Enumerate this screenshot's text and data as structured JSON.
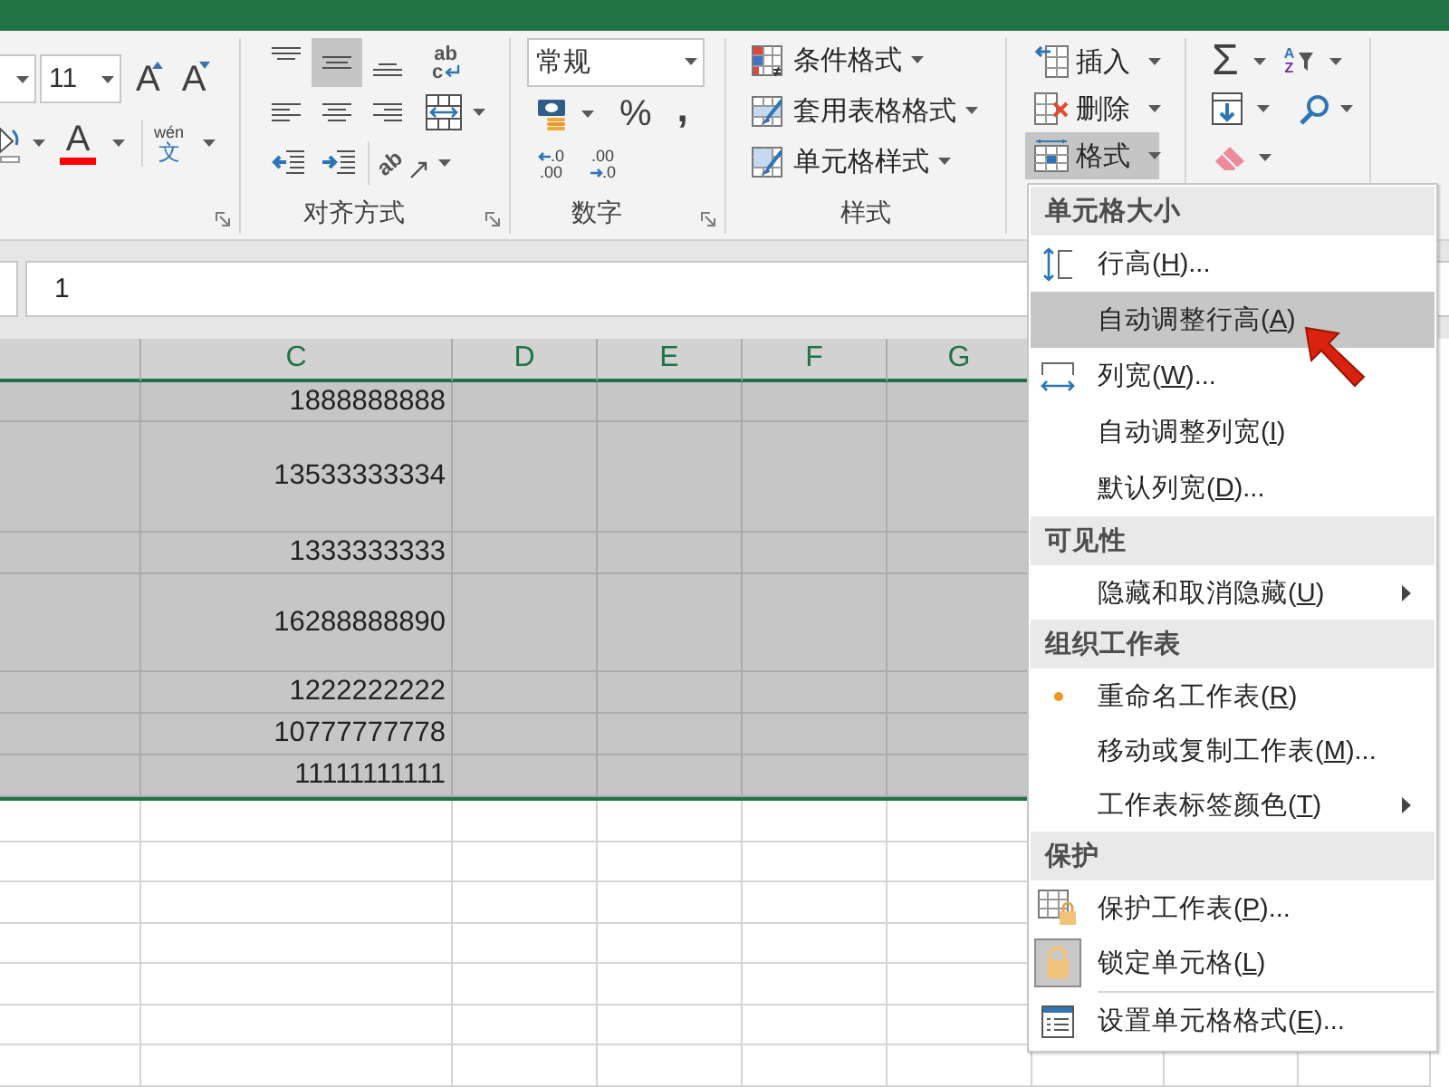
{
  "ribbon": {
    "font_group": {
      "size": "11",
      "grow_glyph": "A",
      "shrink_glyph": "A",
      "color_glyph": "A",
      "phonetic": [
        "wén",
        "文"
      ]
    },
    "alignment_group": {
      "label": "对齐方式",
      "button_rows": [
        [
          {
            "kind": "top",
            "selected": false
          },
          {
            "kind": "middle",
            "selected": true
          },
          {
            "kind": "bottom",
            "selected": false
          },
          {
            "kind": "wrap",
            "selected": false,
            "glyphs": [
              "ab",
              "c"
            ]
          }
        ],
        [
          {
            "kind": "left",
            "selected": false
          },
          {
            "kind": "center",
            "selected": false
          },
          {
            "kind": "right",
            "selected": false
          },
          {
            "kind": "merge",
            "selected": false
          }
        ],
        [
          {
            "kind": "outdent",
            "selected": false
          },
          {
            "kind": "indent",
            "selected": false
          },
          {
            "kind": "orientation",
            "selected": false,
            "glyphs": [
              "ab"
            ]
          }
        ]
      ]
    },
    "number_group": {
      "label": "数字",
      "format": "常规",
      "percent": "%",
      "comma": ",",
      "increase_decimal": [
        ".0",
        ".00"
      ],
      "decrease_decimal": [
        ".00",
        ".0"
      ]
    },
    "styles_group": {
      "label": "样式",
      "buttons": [
        {
          "kind": "conditional",
          "label": "条件格式"
        },
        {
          "kind": "table",
          "label": "套用表格格式"
        },
        {
          "kind": "cell",
          "label": "单元格样式"
        }
      ]
    },
    "cells_group": {
      "buttons": [
        {
          "kind": "insert",
          "label": "插入",
          "selected": false
        },
        {
          "kind": "delete",
          "label": "删除",
          "selected": false
        },
        {
          "kind": "format",
          "label": "格式",
          "selected": true
        }
      ]
    },
    "editing_group": {
      "sum_glyph": "Σ",
      "sort_glyphs": [
        "A",
        "Z"
      ]
    }
  },
  "formula_bar": {
    "value": "1"
  },
  "sheet": {
    "columns": [
      {
        "label": "C",
        "selected": true
      },
      {
        "label": "D",
        "selected": true
      },
      {
        "label": "E",
        "selected": true
      },
      {
        "label": "F",
        "selected": true
      },
      {
        "label": "G",
        "selected": true
      }
    ],
    "rows": [
      {
        "selected": true,
        "cells": [
          "1888888888"
        ]
      },
      {
        "selected": true,
        "cells": [
          "13533333334"
        ]
      },
      {
        "selected": true,
        "cells": [
          "1333333333"
        ]
      },
      {
        "selected": true,
        "cells": [
          "16288888890"
        ]
      },
      {
        "selected": true,
        "cells": [
          "1222222222"
        ]
      },
      {
        "selected": true,
        "cells": [
          "10777777778"
        ]
      },
      {
        "selected": true,
        "cells": [
          "11111111111"
        ]
      },
      {
        "selected": false
      },
      {
        "selected": false
      },
      {
        "selected": false
      },
      {
        "selected": false
      },
      {
        "selected": false
      },
      {
        "selected": false
      },
      {
        "selected": false
      }
    ]
  },
  "context_menu": {
    "sections": [
      {
        "header": "单元格大小",
        "items": [
          {
            "kind": "height",
            "before": "行高(",
            "key": "H",
            "after": ")...",
            "selected": false,
            "submenu": false,
            "checked": false,
            "marked": false
          },
          {
            "kind": "plain",
            "before": "自动调整行高(",
            "key": "A",
            "after": ")",
            "selected": true,
            "submenu": false,
            "checked": false,
            "marked": false
          },
          {
            "kind": "width",
            "before": "列宽(",
            "key": "W",
            "after": ")...",
            "selected": false,
            "submenu": false,
            "checked": false,
            "marked": false
          },
          {
            "kind": "plain",
            "before": "自动调整列宽(",
            "key": "I",
            "after": ")",
            "selected": false,
            "submenu": false,
            "checked": false,
            "marked": false
          },
          {
            "kind": "plain",
            "before": "默认列宽(",
            "key": "D",
            "after": ")...",
            "selected": false,
            "submenu": false,
            "checked": false,
            "marked": false
          }
        ]
      },
      {
        "header": "可见性",
        "items": [
          {
            "kind": "plain",
            "before": "隐藏和取消隐藏(",
            "key": "U",
            "after": ")",
            "selected": false,
            "submenu": true,
            "checked": false,
            "marked": false
          }
        ]
      },
      {
        "header": "组织工作表",
        "items": [
          {
            "kind": "plain",
            "before": "重命名工作表(",
            "key": "R",
            "after": ")",
            "selected": false,
            "submenu": false,
            "checked": false,
            "marked": true
          },
          {
            "kind": "plain",
            "before": "移动或复制工作表(",
            "key": "M",
            "after": ")...",
            "selected": false,
            "submenu": false,
            "checked": false,
            "marked": false
          },
          {
            "kind": "plain",
            "before": "工作表标签颜色(",
            "key": "T",
            "after": ")",
            "selected": false,
            "submenu": true,
            "checked": false,
            "marked": false
          }
        ]
      },
      {
        "header": "保护",
        "items": [
          {
            "kind": "protect",
            "before": "保护工作表(",
            "key": "P",
            "after": ")...",
            "selected": false,
            "submenu": false,
            "checked": false,
            "marked": false
          },
          {
            "kind": "lock",
            "before": "锁定单元格(",
            "key": "L",
            "after": ")",
            "selected": false,
            "submenu": false,
            "checked": true,
            "marked": false
          },
          {
            "kind": "format",
            "before": "设置单元格格式(",
            "key": "E",
            "after": ")...",
            "selected": false,
            "submenu": false,
            "checked": false,
            "marked": false,
            "divider_above": true
          }
        ]
      }
    ]
  }
}
